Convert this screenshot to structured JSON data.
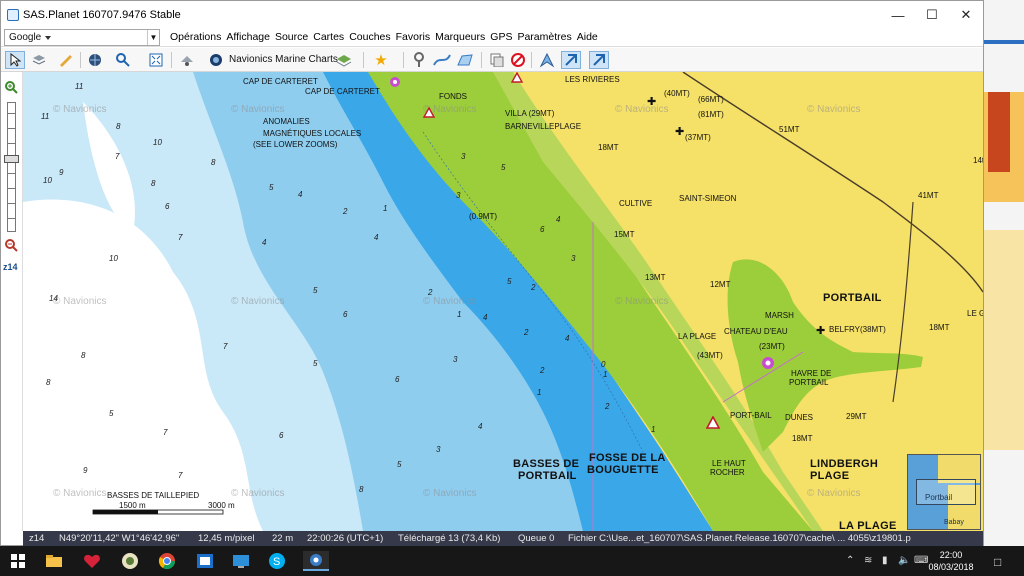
{
  "window": {
    "title": "SAS.Planet 160707.9476 Stable"
  },
  "source_combo": {
    "value": "Google"
  },
  "menu": [
    "Opérations",
    "Affichage",
    "Source",
    "Cartes",
    "Couches",
    "Favoris",
    "Marqueurs",
    "GPS",
    "Paramètres",
    "Aide"
  ],
  "toolbar": {
    "map_layer": "Navionics Marine Charts"
  },
  "zoom": {
    "label": "z14"
  },
  "map": {
    "watermark": "© Navionics",
    "labels_big": [
      "PORTBAIL",
      "LINDBERGH",
      "PLAGE",
      "BASSES DE",
      "PORTBAIL",
      "FOSSE DE LA",
      "BOUGUETTE",
      "LA PLAGE"
    ],
    "labels_small": [
      "CAP DE CARTERET",
      "CAP DE CARTERET",
      "ANOMALIES",
      "MAGNÉTIQUES LOCALES",
      "(SEE LOWER ZOOMS)",
      "LES RIVIERES",
      "FONDS",
      "VILLA (29MT)",
      "BARNEVILLEPLAGE",
      "18MT",
      "(40MT)",
      "(66MT)",
      "(81MT)",
      "(37MT)",
      "51MT",
      "CULTIVE",
      "SAINT-SIMEON",
      "41MT",
      "15MT",
      "13MT",
      "12MT",
      "LA PLAGE",
      "CHATEAU D'EAU",
      "(43MT)",
      "MARSH",
      "BELFRY(38MT)",
      "(23MT)",
      "HAVRE DE",
      "PORTBAIL",
      "18MT",
      "29MT",
      "DUNES",
      "18MT",
      "LE HAUT",
      "ROCHER",
      "PORT-BAIL",
      "(0.9MT)",
      "BASSES DE TAILLEPIED",
      "1500 m",
      "3000 m",
      "LE G",
      "14t"
    ],
    "depths": [
      "11",
      "11",
      "8",
      "10",
      "10",
      "9",
      "8",
      "14",
      "10",
      "7",
      "7",
      "6",
      "8",
      "5",
      "4",
      "4",
      "2",
      "1",
      "3",
      "4",
      "5",
      "6",
      "7",
      "8",
      "5",
      "3",
      "4",
      "2",
      "6",
      "5",
      "8",
      "7",
      "9",
      "6",
      "5",
      "3",
      "4",
      "1",
      "2",
      "3",
      "5",
      "4",
      "6",
      "7",
      "8",
      "5",
      "1",
      "3",
      "2",
      "4",
      "1",
      "2",
      "2",
      "1",
      "0"
    ]
  },
  "minimap": {
    "label": "Portbail",
    "label2": "Babay"
  },
  "status": {
    "zoom": "z14",
    "coords": "N49°20'11,42\" W1°46'42,96\"",
    "scale": "12,45 m/pixel",
    "altitude": "22 m",
    "time": "22:00:26 (UTC+1)",
    "downloaded": "Téléchargé 13 (73,4 Kb)",
    "queue": "Queue 0",
    "file": "Fichier C:\\Use...et_160707\\SAS.Planet.Release.160707\\cache\\ ... 4055\\z19801.p"
  },
  "taskbar": {
    "time": "22:00",
    "date": "08/03/2018"
  },
  "colors": {
    "land": "#f5e168",
    "green": "#9ccd3a",
    "shallow": "#3aa7e8",
    "mid": "#8fcdef",
    "deep": "#c9e8f8",
    "white": "#ffffff"
  }
}
